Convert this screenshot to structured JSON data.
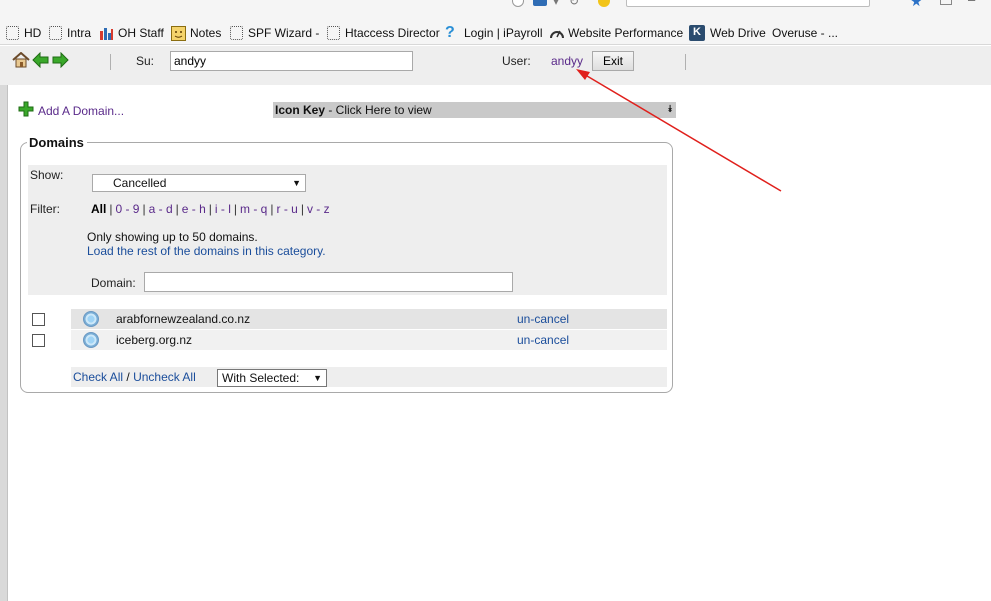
{
  "bookmarks": [
    {
      "label": "HD",
      "icon": "page-icon"
    },
    {
      "label": "Intra",
      "icon": "page-icon"
    },
    {
      "label": "OH Staff",
      "icon": "bar-chart-icon"
    },
    {
      "label": "Notes",
      "icon": "notes-icon"
    },
    {
      "label": "SPF Wizard -",
      "icon": "page-icon"
    },
    {
      "label": "Htaccess Director",
      "icon": "page-icon"
    },
    {
      "label": "Login | iPayroll",
      "icon": "question-icon"
    },
    {
      "label": "Website Performance",
      "icon": "gauge-icon"
    },
    {
      "label": "Web Drive",
      "icon": "k-logo-icon"
    },
    {
      "label": "Overuse - ...",
      "icon": "none"
    }
  ],
  "toolbar": {
    "su_label": "Su:",
    "su_value": "andyy",
    "user_label": "User:",
    "user_name": "andyy",
    "exit_label": "Exit"
  },
  "content": {
    "add_domain": "Add A Domain...",
    "icon_key_bold": "Icon Key",
    "icon_key_rest": " - Click Here to view",
    "domains_title": "Domains",
    "show_label": "Show:",
    "show_value": "Cancelled",
    "filter_label": "Filter:",
    "filters": [
      "All",
      "0 - 9",
      "a - d",
      "e - h",
      "i - l",
      "m - q",
      "r - u",
      "v - z"
    ],
    "info_text": "Only showing up to 50 domains.",
    "load_rest": "Load the rest of the domains in this category.",
    "domain_label": "Domain:",
    "rows": [
      {
        "domain": "arabfornewzealand.co.nz",
        "action": "un-cancel"
      },
      {
        "domain": "iceberg.org.nz",
        "action": "un-cancel"
      }
    ],
    "check_all": "Check All",
    "slash": "/",
    "uncheck_all": "Uncheck All",
    "with_selected": "With Selected:"
  },
  "colors": {
    "link_visited": "#5a2a8a",
    "link": "#1a4d9b",
    "annotation_arrow": "#e0201c",
    "nav_arrow": "#3aa82a"
  }
}
